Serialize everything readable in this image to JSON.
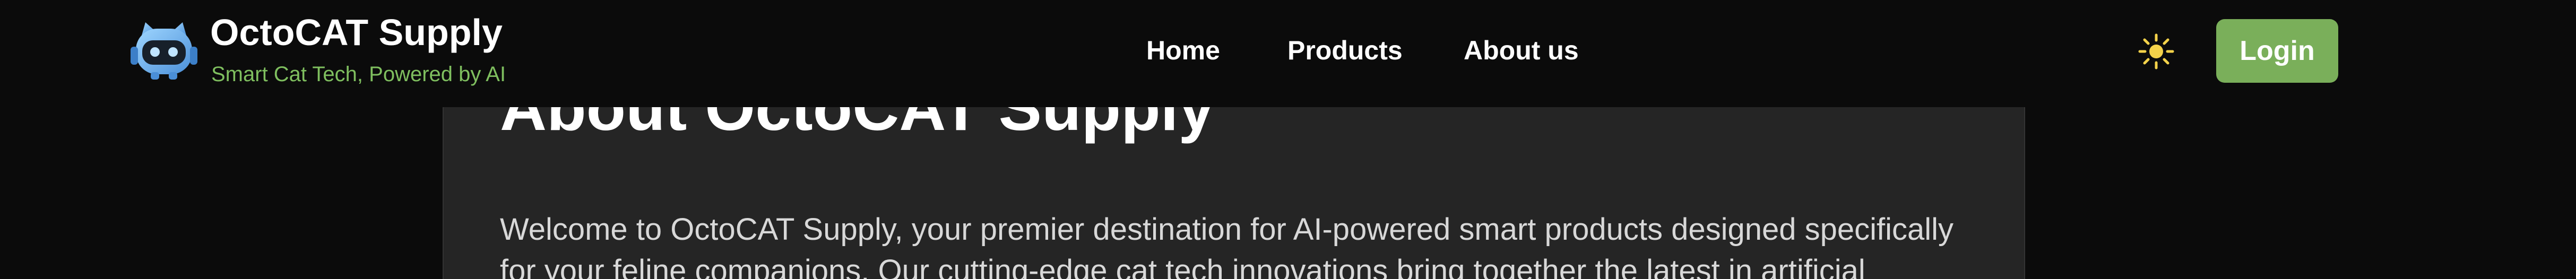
{
  "header": {
    "brand_title": "OctoCAT Supply",
    "brand_tagline": "Smart Cat Tech, Powered by AI",
    "logo_icon": "octocat-robot-logo-icon",
    "nav": [
      {
        "label": "Home"
      },
      {
        "label": "Products"
      },
      {
        "label": "About us"
      }
    ],
    "theme_toggle_icon": "sun-icon",
    "login_label": "Login"
  },
  "main": {
    "heading": "About OctoCAT Supply",
    "intro": "Welcome to OctoCAT Supply, your premier destination for AI-powered smart products designed specifically for your feline companions. Our cutting-edge cat tech innovations bring together the latest in artificial"
  },
  "colors": {
    "background": "#0b0b0b",
    "card": "#252525",
    "accent_green": "#7aaf5a",
    "tagline_green": "#7fbf5f",
    "sun_yellow": "#f4d24a"
  }
}
